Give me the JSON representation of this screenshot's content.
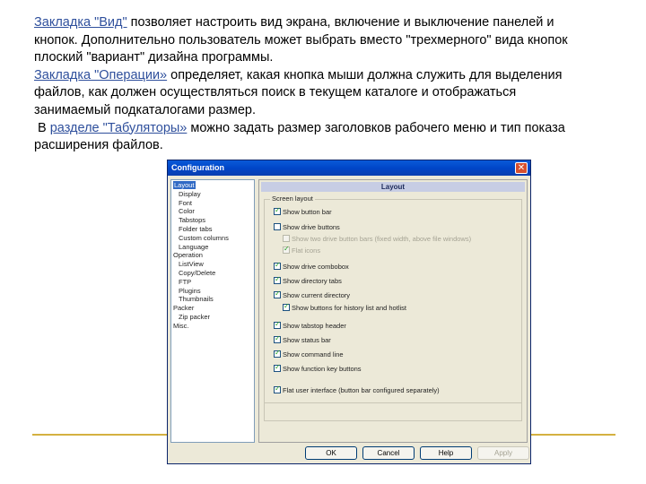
{
  "slide": {
    "para1_link": "Закладка \"Вид\"",
    "para1_line1_rest": " позволяет настроить вид экрана, включение и выключение панелей и",
    "para1_line2": "кнопок. Дополнительно пользователь может выбрать вместо \"трехмерного\" вида кнопок",
    "para1_line3": "плоский \"вариант\" дизайна программы.",
    "para2_link": "Закладка \"Операции»",
    "para2_line1_rest": " определяет, какая кнопка мыши должна служить для выделения",
    "para2_line2": "файлов, как должен осуществляться поиск в текущем каталоге и отображаться",
    "para2_line3": "занимаемый подкаталогами размер.",
    "para3_prefix": " В ",
    "para3_link": "разделе \"Табуляторы»",
    "para3_line1_rest": " можно задать размер заголовков рабочего меню и тип показа",
    "para3_line2": "расширения файлов.",
    "accent_color": "#d4b140",
    "link_color": "#2e4f9c"
  },
  "window": {
    "title": "Configuration",
    "close_glyph": "✕",
    "tree": [
      {
        "label": "Layout",
        "level": 0,
        "selected": true
      },
      {
        "label": "Display",
        "level": 1
      },
      {
        "label": "Font",
        "level": 1
      },
      {
        "label": "Color",
        "level": 1
      },
      {
        "label": "Tabstops",
        "level": 1
      },
      {
        "label": "Folder tabs",
        "level": 1
      },
      {
        "label": "Custom columns",
        "level": 1
      },
      {
        "label": "Language",
        "level": 1
      },
      {
        "label": "Operation",
        "level": 0
      },
      {
        "label": "ListView",
        "level": 1
      },
      {
        "label": "Copy/Delete",
        "level": 1
      },
      {
        "label": "FTP",
        "level": 1
      },
      {
        "label": "Plugins",
        "level": 1
      },
      {
        "label": "Thumbnails",
        "level": 1
      },
      {
        "label": "Packer",
        "level": 0
      },
      {
        "label": "Zip packer",
        "level": 1
      },
      {
        "label": "Misc.",
        "level": 0
      }
    ],
    "panel_title": "Layout",
    "group_label": "Screen layout",
    "options": {
      "button_bar": {
        "label": "Show button bar",
        "checked": true
      },
      "drive_buttons": {
        "label": "Show drive buttons",
        "checked": false
      },
      "two_drive_bars": {
        "label": "Show two drive button bars (fixed width, above file windows)",
        "checked": false,
        "disabled": true
      },
      "flat_icons": {
        "label": "Flat icons",
        "checked": true,
        "disabled": true
      },
      "drive_combobox": {
        "label": "Show drive combobox",
        "checked": true
      },
      "directory_tabs": {
        "label": "Show directory tabs",
        "checked": true
      },
      "current_directory": {
        "label": "Show current directory",
        "checked": true
      },
      "history_buttons": {
        "label": "Show buttons for history list and hotlist",
        "checked": true
      },
      "tabstop_header": {
        "label": "Show tabstop header",
        "checked": true
      },
      "status_bar": {
        "label": "Show status bar",
        "checked": true
      },
      "command_line": {
        "label": "Show command line",
        "checked": true
      },
      "function_key_buttons": {
        "label": "Show function key buttons",
        "checked": true
      },
      "flat_interface": {
        "label": "Flat user interface (button bar configured separately)",
        "checked": true
      }
    },
    "buttons": {
      "ok": "OK",
      "cancel": "Cancel",
      "help": "Help",
      "apply": "Apply"
    }
  }
}
